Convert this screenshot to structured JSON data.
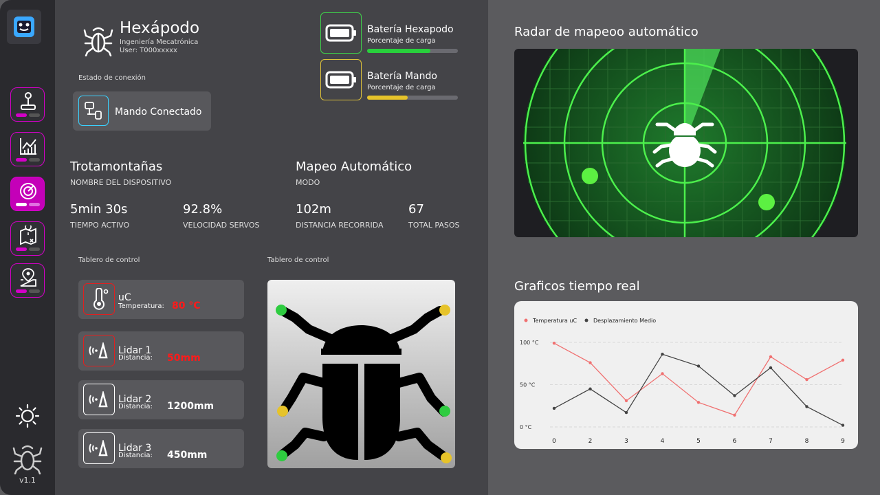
{
  "app": {
    "version": "v1.1"
  },
  "header": {
    "title": "Hexápodo",
    "subtitle": "Ingeniería Mecatrónica",
    "user": "User: T000xxxxx"
  },
  "batteries": [
    {
      "title": "Batería Hexapodo",
      "subtitle": "Porcentaje de carga",
      "level": 0.7,
      "color": "#28d03c",
      "border": "#3fd14a"
    },
    {
      "title": "Batería Mando",
      "subtitle": "Porcentaje de carga",
      "level": 0.45,
      "color": "#e6c32a",
      "border": "#e0c33a"
    }
  ],
  "connection": {
    "label": "Estado de conexión",
    "status": "Mando Conectado"
  },
  "device": {
    "name": "Trotamontañas",
    "name_label": "NOMBRE DEL DISPOSITIVO",
    "mode": "Mapeo Automático",
    "mode_label": "MODO"
  },
  "stats": [
    {
      "value": "5min 30s",
      "label": "TIEMPO ACTIVO"
    },
    {
      "value": "92.8%",
      "label": "VELOCIDAD SERVOS"
    },
    {
      "value": "102m",
      "label": "DISTANCIA RECORRIDA"
    },
    {
      "value": "67",
      "label": "TOTAL PASOS"
    }
  ],
  "control_label_1": "Tablero de control",
  "control_label_2": "Tablero de control",
  "sensors": [
    {
      "name": "uC",
      "key": "Temperatura:",
      "value": "80 °C",
      "alert": true
    },
    {
      "name": "Lidar 1",
      "key": "Distancia:",
      "value": "50mm",
      "alert": true
    },
    {
      "name": "Lidar 2",
      "key": "Distancia:",
      "value": "1200mm",
      "alert": false
    },
    {
      "name": "Lidar 3",
      "key": "Distancia:",
      "value": "450mm",
      "alert": false
    }
  ],
  "radar": {
    "title": "Radar de mapeoo automático"
  },
  "chart_title": "Graficos tiempo real",
  "chart_data": {
    "type": "line",
    "x": [
      "0",
      "2",
      "3",
      "4",
      "5",
      "6",
      "7",
      "8",
      "9"
    ],
    "y_ticks": [
      "100 °C",
      "50 °C",
      "0 °C"
    ],
    "ylim": [
      0,
      100
    ],
    "legend_position": "top-left",
    "series": [
      {
        "name": "Temperatura uC",
        "color": "#f07070",
        "values": [
          99,
          76,
          31,
          63,
          29,
          14,
          83,
          56,
          79
        ]
      },
      {
        "name": "Desplazamiento Medio",
        "color": "#444444",
        "values": [
          22,
          45,
          17,
          86,
          72,
          37,
          70,
          24,
          2
        ]
      }
    ],
    "grid": true
  }
}
